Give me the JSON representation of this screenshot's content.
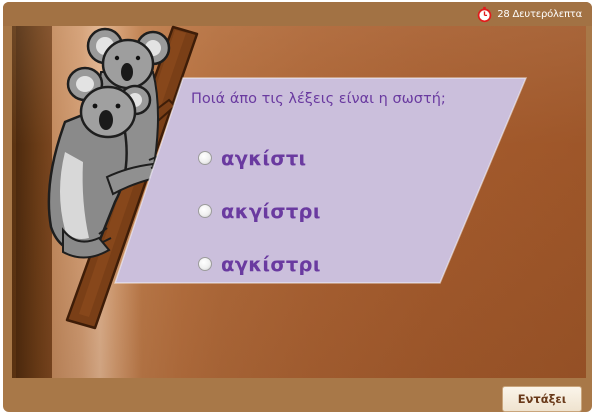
{
  "timer": {
    "icon": "stopwatch-icon",
    "label": "28 Δευτερόλεπτα",
    "icon_color": "#e02020"
  },
  "quiz": {
    "question": "Ποιά άπο τις λέξεις είναι η σωστή;",
    "options": [
      {
        "label": "αγκίστι",
        "selected": false
      },
      {
        "label": "ακγίστρι",
        "selected": false
      },
      {
        "label": "αγκίστρι",
        "selected": false
      }
    ]
  },
  "footer": {
    "ok_label": "Εντάξει"
  },
  "colors": {
    "text_accent": "#6a3aa0",
    "panel": "#cbbfdc",
    "frame": "#a87848"
  }
}
